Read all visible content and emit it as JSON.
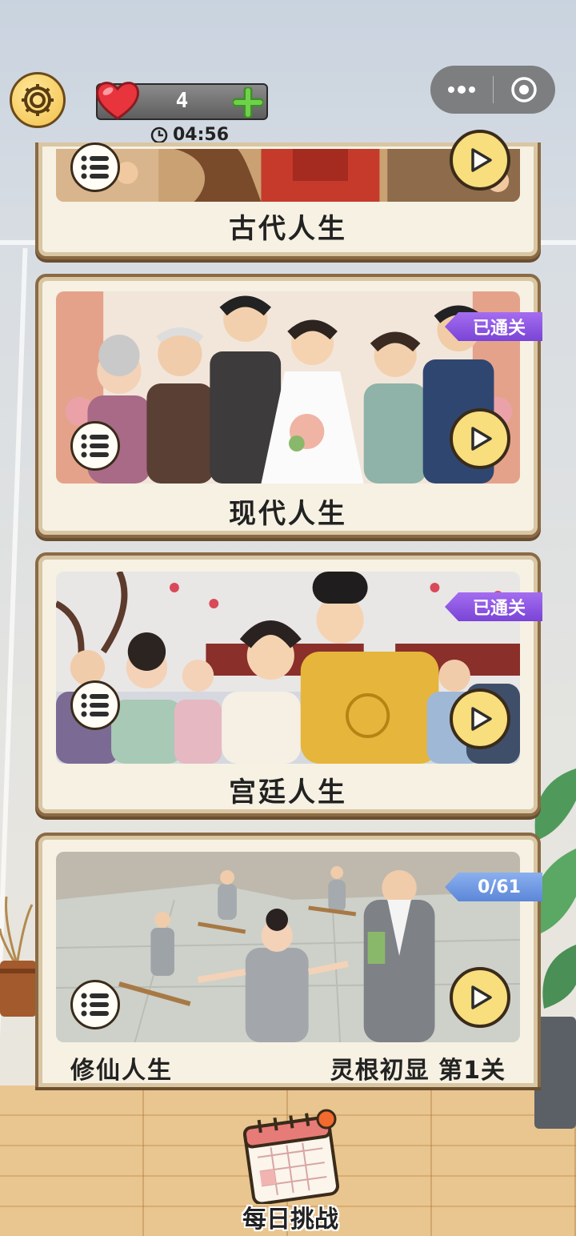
{
  "header": {
    "lives": "4",
    "timer": "04:56"
  },
  "levels": [
    {
      "title": "古代人生"
    },
    {
      "title": "现代人生",
      "badge": "已通关"
    },
    {
      "title": "宫廷人生",
      "badge": "已通关"
    },
    {
      "title": "修仙人生",
      "badge": "0/61",
      "stage": "灵根初显 第1关"
    }
  ],
  "daily": {
    "label": "每日挑战"
  },
  "colors": {
    "card_border": "#8a6a45",
    "play_button": "#f8de7c",
    "badge_done": "#8a55e0",
    "badge_progress": "#6f97e2"
  }
}
